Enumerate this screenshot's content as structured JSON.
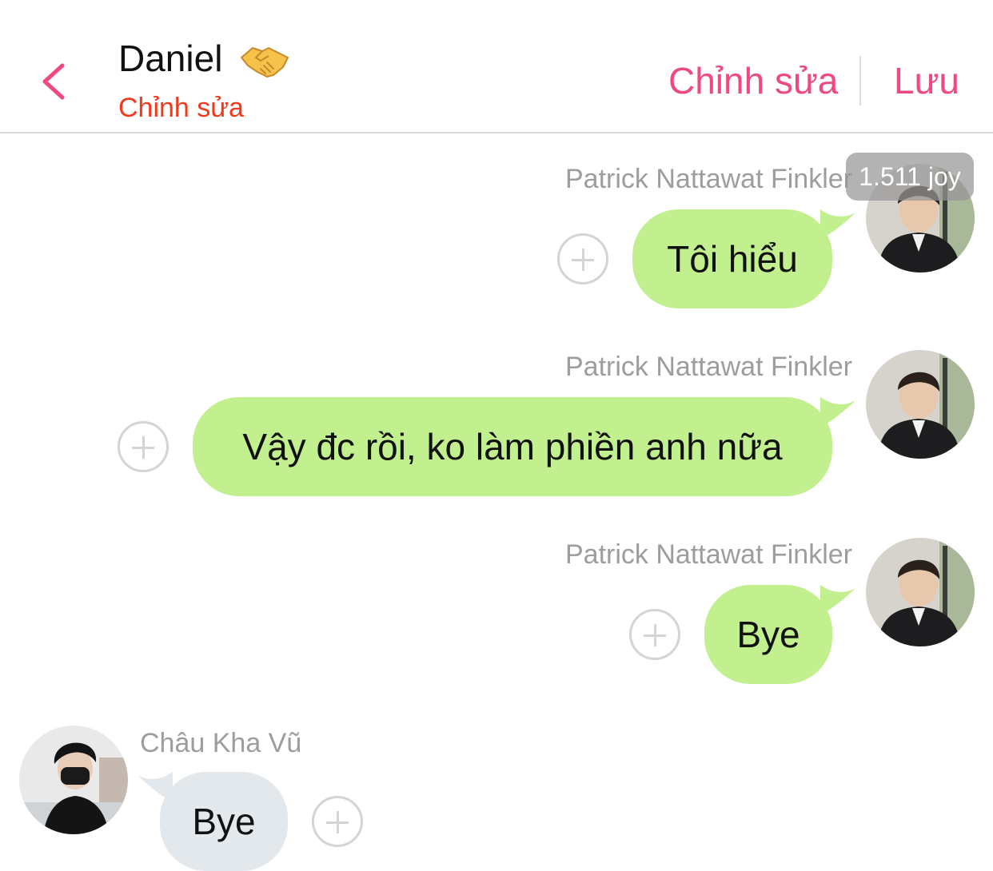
{
  "header": {
    "title": "Daniel",
    "title_emoji_icon": "handshake-icon",
    "subtitle": "Chỉnh sửa",
    "edit_label": "Chỉnh sửa",
    "save_label": "Lưu",
    "accent_color": "#f0497f"
  },
  "messages": [
    {
      "sender": "Patrick Nattawat Finkler",
      "text": "Tôi hiểu",
      "side": "right",
      "bubble_color": "#c3f08f"
    },
    {
      "sender": "Patrick Nattawat Finkler",
      "text": "Vậy đc rồi, ko làm phiền anh nữa",
      "side": "right",
      "bubble_color": "#c3f08f"
    },
    {
      "sender": "Patrick Nattawat Finkler",
      "text": "Bye",
      "side": "right",
      "bubble_color": "#c3f08f"
    },
    {
      "sender": "Châu Kha Vũ",
      "text": "Bye",
      "side": "left",
      "bubble_color": "#e3e8ed"
    }
  ],
  "joy_badge": "1.511 joy"
}
